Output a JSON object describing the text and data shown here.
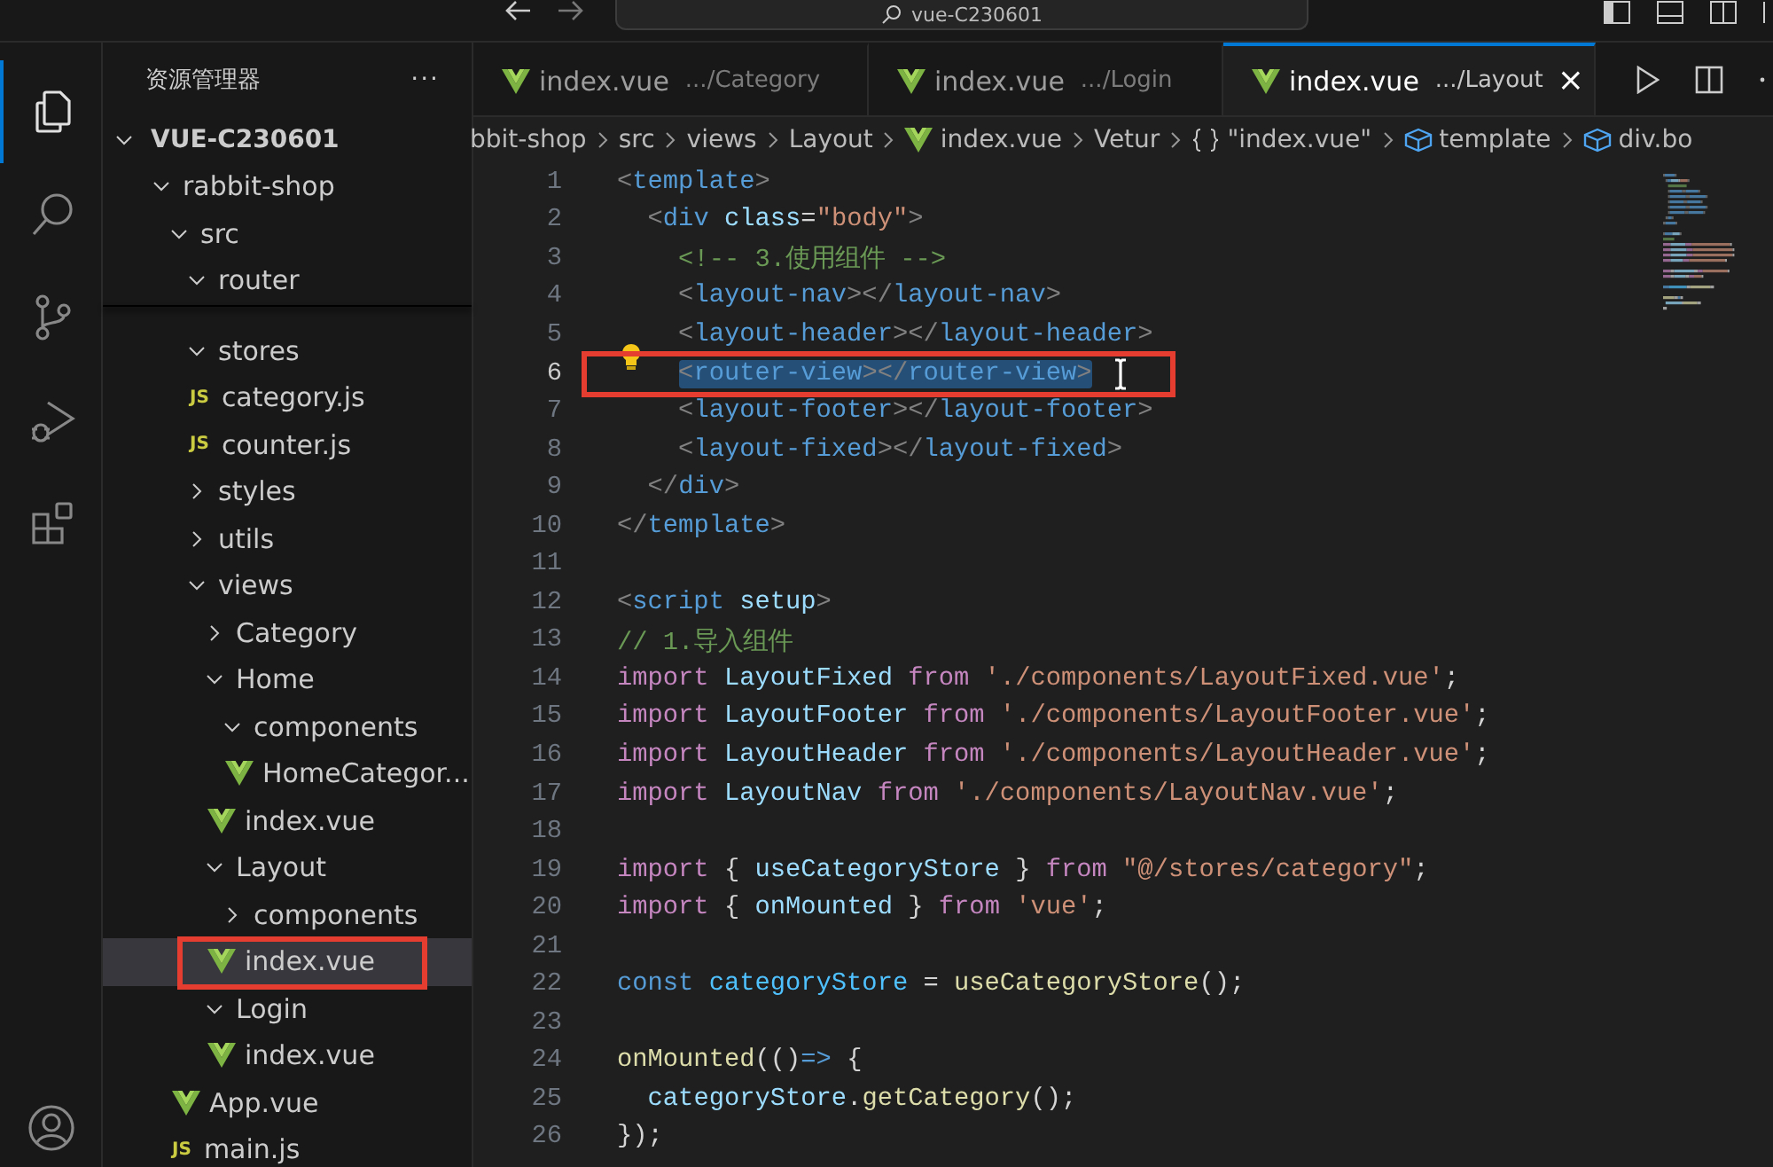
{
  "title_bar": {
    "search": "vue-C230601"
  },
  "activity_bar": [
    {
      "kind": "files",
      "selected": true
    },
    {
      "kind": "search",
      "selected": false
    },
    {
      "kind": "git",
      "selected": false
    },
    {
      "kind": "debug",
      "selected": false
    },
    {
      "kind": "extensions",
      "selected": false
    }
  ],
  "explorer": {
    "title": "资源管理器",
    "more": "···",
    "root": "VUE-C230601",
    "tree": [
      {
        "name": "rabbit-shop",
        "kind": "folder",
        "expanded": true,
        "children": [
          {
            "name": "src",
            "kind": "folder",
            "expanded": true,
            "children": [
              {
                "name": "router",
                "kind": "folder",
                "expanded": true
              },
              {
                "name": "stores",
                "kind": "folder",
                "expanded": true,
                "children": [
                  {
                    "name": "category.js",
                    "kind": "js",
                    "badge": "JS"
                  },
                  {
                    "name": "counter.js",
                    "kind": "js",
                    "badge": "JS"
                  }
                ]
              },
              {
                "name": "styles",
                "kind": "folder",
                "expanded": false
              },
              {
                "name": "utils",
                "kind": "folder",
                "expanded": false
              },
              {
                "name": "views",
                "kind": "folder",
                "expanded": true,
                "children": [
                  {
                    "name": "Category",
                    "kind": "folder",
                    "expanded": false
                  },
                  {
                    "name": "Home",
                    "kind": "folder",
                    "expanded": true,
                    "children": [
                      {
                        "name": "components",
                        "kind": "folder",
                        "expanded": true,
                        "children": [
                          {
                            "name": "HomeCategor...",
                            "kind": "vue"
                          }
                        ]
                      },
                      {
                        "name": "index.vue",
                        "kind": "vue"
                      }
                    ]
                  },
                  {
                    "name": "Layout",
                    "kind": "folder",
                    "expanded": true,
                    "children": [
                      {
                        "name": "components",
                        "kind": "folder",
                        "expanded": false
                      },
                      {
                        "name": "index.vue",
                        "kind": "vue",
                        "selected": true,
                        "annotated": true
                      }
                    ]
                  },
                  {
                    "name": "Login",
                    "kind": "folder",
                    "expanded": true,
                    "children": [
                      {
                        "name": "index.vue",
                        "kind": "vue"
                      }
                    ]
                  }
                ]
              },
              {
                "name": "App.vue",
                "kind": "vue"
              },
              {
                "name": "main.js",
                "kind": "js",
                "badge": "JS"
              }
            ]
          }
        ]
      }
    ]
  },
  "tabs": [
    {
      "name": "index.vue",
      "path": ".../Category",
      "selected": false
    },
    {
      "name": "index.vue",
      "path": ".../Login",
      "selected": false
    },
    {
      "name": "index.vue",
      "path": ".../Layout",
      "selected": true,
      "close": "×"
    }
  ],
  "breadcrumb": [
    {
      "text": "bbit-shop"
    },
    {
      "text": "src"
    },
    {
      "text": "views"
    },
    {
      "text": "Layout"
    },
    {
      "text": "index.vue",
      "kind": "vue"
    },
    {
      "text": "Vetur"
    },
    {
      "text": "\"index.vue\"",
      "kind": "braces"
    },
    {
      "text": "template",
      "kind": "cube"
    },
    {
      "text": "div.bo",
      "kind": "cube"
    }
  ],
  "code": [
    {
      "n": "1",
      "t": [
        {
          "kind": "p",
          "text": "<"
        },
        {
          "kind": "tag",
          "text": "template"
        },
        {
          "kind": "p",
          "text": ">"
        }
      ]
    },
    {
      "n": "2",
      "t": [
        {
          "kind": "p",
          "text": "  <"
        },
        {
          "kind": "tag",
          "text": "div"
        },
        {
          "kind": "attr",
          "text": " class"
        },
        {
          "kind": "txt",
          "text": "="
        },
        {
          "kind": "str",
          "text": "\"body\""
        },
        {
          "kind": "p",
          "text": ">"
        }
      ]
    },
    {
      "n": "3",
      "t": [
        {
          "kind": "cmt",
          "text": "    <!-- 3.使用组件 -->"
        }
      ]
    },
    {
      "n": "4",
      "t": [
        {
          "kind": "p",
          "text": "    <"
        },
        {
          "kind": "tag",
          "text": "layout-nav"
        },
        {
          "kind": "p",
          "text": "></"
        },
        {
          "kind": "tag",
          "text": "layout-nav"
        },
        {
          "kind": "p",
          "text": ">"
        }
      ]
    },
    {
      "n": "5",
      "t": [
        {
          "kind": "p",
          "text": "    <"
        },
        {
          "kind": "tag",
          "text": "layout-header"
        },
        {
          "kind": "p",
          "text": "></"
        },
        {
          "kind": "tag",
          "text": "layout-header"
        },
        {
          "kind": "p",
          "text": ">"
        }
      ]
    },
    {
      "n": "6",
      "current": true,
      "selected": true,
      "annotated": true,
      "lightbulb": true,
      "t": [
        {
          "kind": "p",
          "text": "    <"
        },
        {
          "kind": "tag",
          "text": "router-view"
        },
        {
          "kind": "p",
          "text": "></"
        },
        {
          "kind": "tag",
          "text": "router-view"
        },
        {
          "kind": "p",
          "text": ">"
        }
      ]
    },
    {
      "n": "7",
      "t": [
        {
          "kind": "p",
          "text": "    <"
        },
        {
          "kind": "tag",
          "text": "layout-footer"
        },
        {
          "kind": "p",
          "text": "></"
        },
        {
          "kind": "tag",
          "text": "layout-footer"
        },
        {
          "kind": "p",
          "text": ">"
        }
      ]
    },
    {
      "n": "8",
      "t": [
        {
          "kind": "p",
          "text": "    <"
        },
        {
          "kind": "tag",
          "text": "layout-fixed"
        },
        {
          "kind": "p",
          "text": "></"
        },
        {
          "kind": "tag",
          "text": "layout-fixed"
        },
        {
          "kind": "p",
          "text": ">"
        }
      ]
    },
    {
      "n": "9",
      "t": [
        {
          "kind": "p",
          "text": "  </"
        },
        {
          "kind": "tag",
          "text": "div"
        },
        {
          "kind": "p",
          "text": ">"
        }
      ]
    },
    {
      "n": "10",
      "t": [
        {
          "kind": "p",
          "text": "</"
        },
        {
          "kind": "tag",
          "text": "template"
        },
        {
          "kind": "p",
          "text": ">"
        }
      ]
    },
    {
      "n": "11"
    },
    {
      "n": "12",
      "t": [
        {
          "kind": "p",
          "text": "<"
        },
        {
          "kind": "tag",
          "text": "script"
        },
        {
          "kind": "attr",
          "text": " setup"
        },
        {
          "kind": "p",
          "text": ">"
        }
      ]
    },
    {
      "n": "13",
      "t": [
        {
          "kind": "cmt",
          "text": "// 1.导入组件"
        }
      ]
    },
    {
      "n": "14",
      "t": [
        {
          "kind": "kw",
          "text": "import"
        },
        {
          "kind": "var",
          "text": " LayoutFixed"
        },
        {
          "kind": "kw",
          "text": " from"
        },
        {
          "kind": "str",
          "text": " './components/LayoutFixed.vue'"
        },
        {
          "kind": "txt",
          "text": ";"
        }
      ]
    },
    {
      "n": "15",
      "t": [
        {
          "kind": "kw",
          "text": "import"
        },
        {
          "kind": "var",
          "text": " LayoutFooter"
        },
        {
          "kind": "kw",
          "text": " from"
        },
        {
          "kind": "str",
          "text": " './components/LayoutFooter.vue'"
        },
        {
          "kind": "txt",
          "text": ";"
        }
      ]
    },
    {
      "n": "16",
      "t": [
        {
          "kind": "kw",
          "text": "import"
        },
        {
          "kind": "var",
          "text": " LayoutHeader"
        },
        {
          "kind": "kw",
          "text": " from"
        },
        {
          "kind": "str",
          "text": " './components/LayoutHeader.vue'"
        },
        {
          "kind": "txt",
          "text": ";"
        }
      ]
    },
    {
      "n": "17",
      "t": [
        {
          "kind": "kw",
          "text": "import"
        },
        {
          "kind": "var",
          "text": " LayoutNav"
        },
        {
          "kind": "kw",
          "text": " from"
        },
        {
          "kind": "str",
          "text": " './components/LayoutNav.vue'"
        },
        {
          "kind": "txt",
          "text": ";"
        }
      ]
    },
    {
      "n": "18"
    },
    {
      "n": "19",
      "t": [
        {
          "kind": "kw",
          "text": "import"
        },
        {
          "kind": "txt",
          "text": " { "
        },
        {
          "kind": "var",
          "text": "useCategoryStore"
        },
        {
          "kind": "txt",
          "text": " } "
        },
        {
          "kind": "kw",
          "text": "from"
        },
        {
          "kind": "str",
          "text": " \"@/stores/category\""
        },
        {
          "kind": "txt",
          "text": ";"
        }
      ]
    },
    {
      "n": "20",
      "t": [
        {
          "kind": "kw",
          "text": "import"
        },
        {
          "kind": "txt",
          "text": " { "
        },
        {
          "kind": "var",
          "text": "onMounted"
        },
        {
          "kind": "txt",
          "text": " } "
        },
        {
          "kind": "kw",
          "text": "from"
        },
        {
          "kind": "str",
          "text": " 'vue'"
        },
        {
          "kind": "txt",
          "text": ";"
        }
      ]
    },
    {
      "n": "21"
    },
    {
      "n": "22",
      "t": [
        {
          "kind": "const",
          "text": "const"
        },
        {
          "kind": "cvar",
          "text": " categoryStore"
        },
        {
          "kind": "txt",
          "text": " = "
        },
        {
          "kind": "fn",
          "text": "useCategoryStore"
        },
        {
          "kind": "txt",
          "text": "();"
        }
      ]
    },
    {
      "n": "23"
    },
    {
      "n": "24",
      "t": [
        {
          "kind": "fn",
          "text": "onMounted"
        },
        {
          "kind": "txt",
          "text": "(()"
        },
        {
          "kind": "const",
          "text": "=>"
        },
        {
          "kind": "txt",
          "text": " {"
        }
      ]
    },
    {
      "n": "25",
      "t": [
        {
          "kind": "var",
          "text": "  categoryStore"
        },
        {
          "kind": "txt",
          "text": "."
        },
        {
          "kind": "fn",
          "text": "getCategory"
        },
        {
          "kind": "txt",
          "text": "();"
        }
      ]
    },
    {
      "n": "26",
      "t": [
        {
          "kind": "txt",
          "text": "});"
        }
      ]
    }
  ]
}
